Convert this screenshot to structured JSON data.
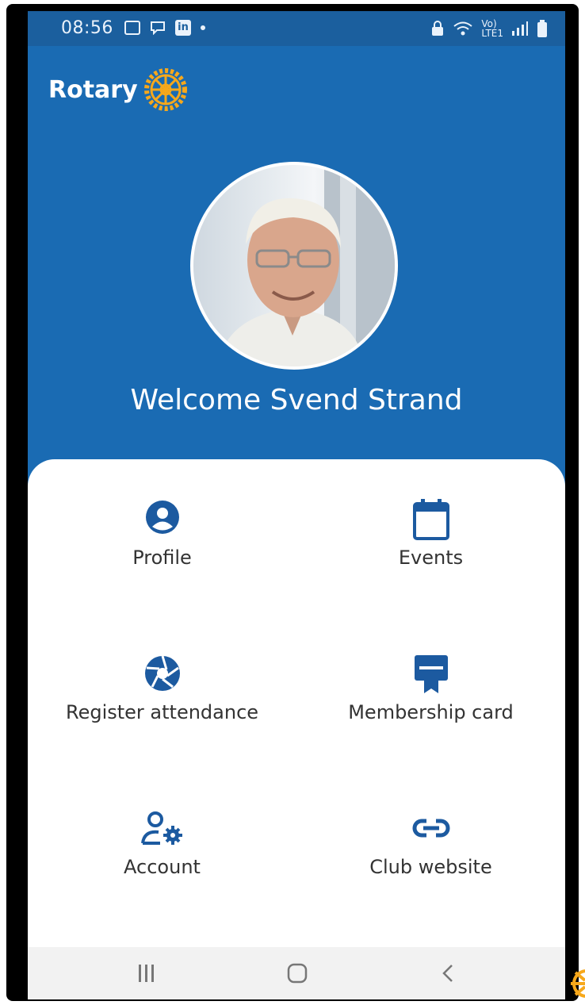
{
  "status_bar": {
    "time": "08:56",
    "left_icons": [
      "gallery-icon",
      "chat-icon",
      "linkedin-icon",
      "dot-icon"
    ],
    "right_icons": [
      "vpn-lock-icon",
      "wifi-icon",
      "volte-icon",
      "signal-icon",
      "battery-icon"
    ],
    "linkedin_label": "in",
    "volte_top": "Vo)",
    "volte_bottom": "LTE1"
  },
  "header": {
    "logo_text": "Rotary",
    "brand_color": "#1a6bb3",
    "logo_color": "#f7a81b"
  },
  "profile": {
    "welcome": "Welcome Svend Strand"
  },
  "menu": {
    "icon_color": "#1c5aa0",
    "items": [
      {
        "label": "Profile",
        "icon": "user-circle-icon"
      },
      {
        "label": "Events",
        "icon": "calendar-icon"
      },
      {
        "label": "Register attendance",
        "icon": "camera-shutter-icon"
      },
      {
        "label": "Membership card",
        "icon": "badge-card-icon"
      },
      {
        "label": "Account",
        "icon": "user-gear-icon"
      },
      {
        "label": "Club website",
        "icon": "link-icon"
      }
    ]
  },
  "nav_bar": {
    "recents_icon": "recents-icon",
    "home_icon": "home-icon",
    "back_icon": "back-icon"
  }
}
